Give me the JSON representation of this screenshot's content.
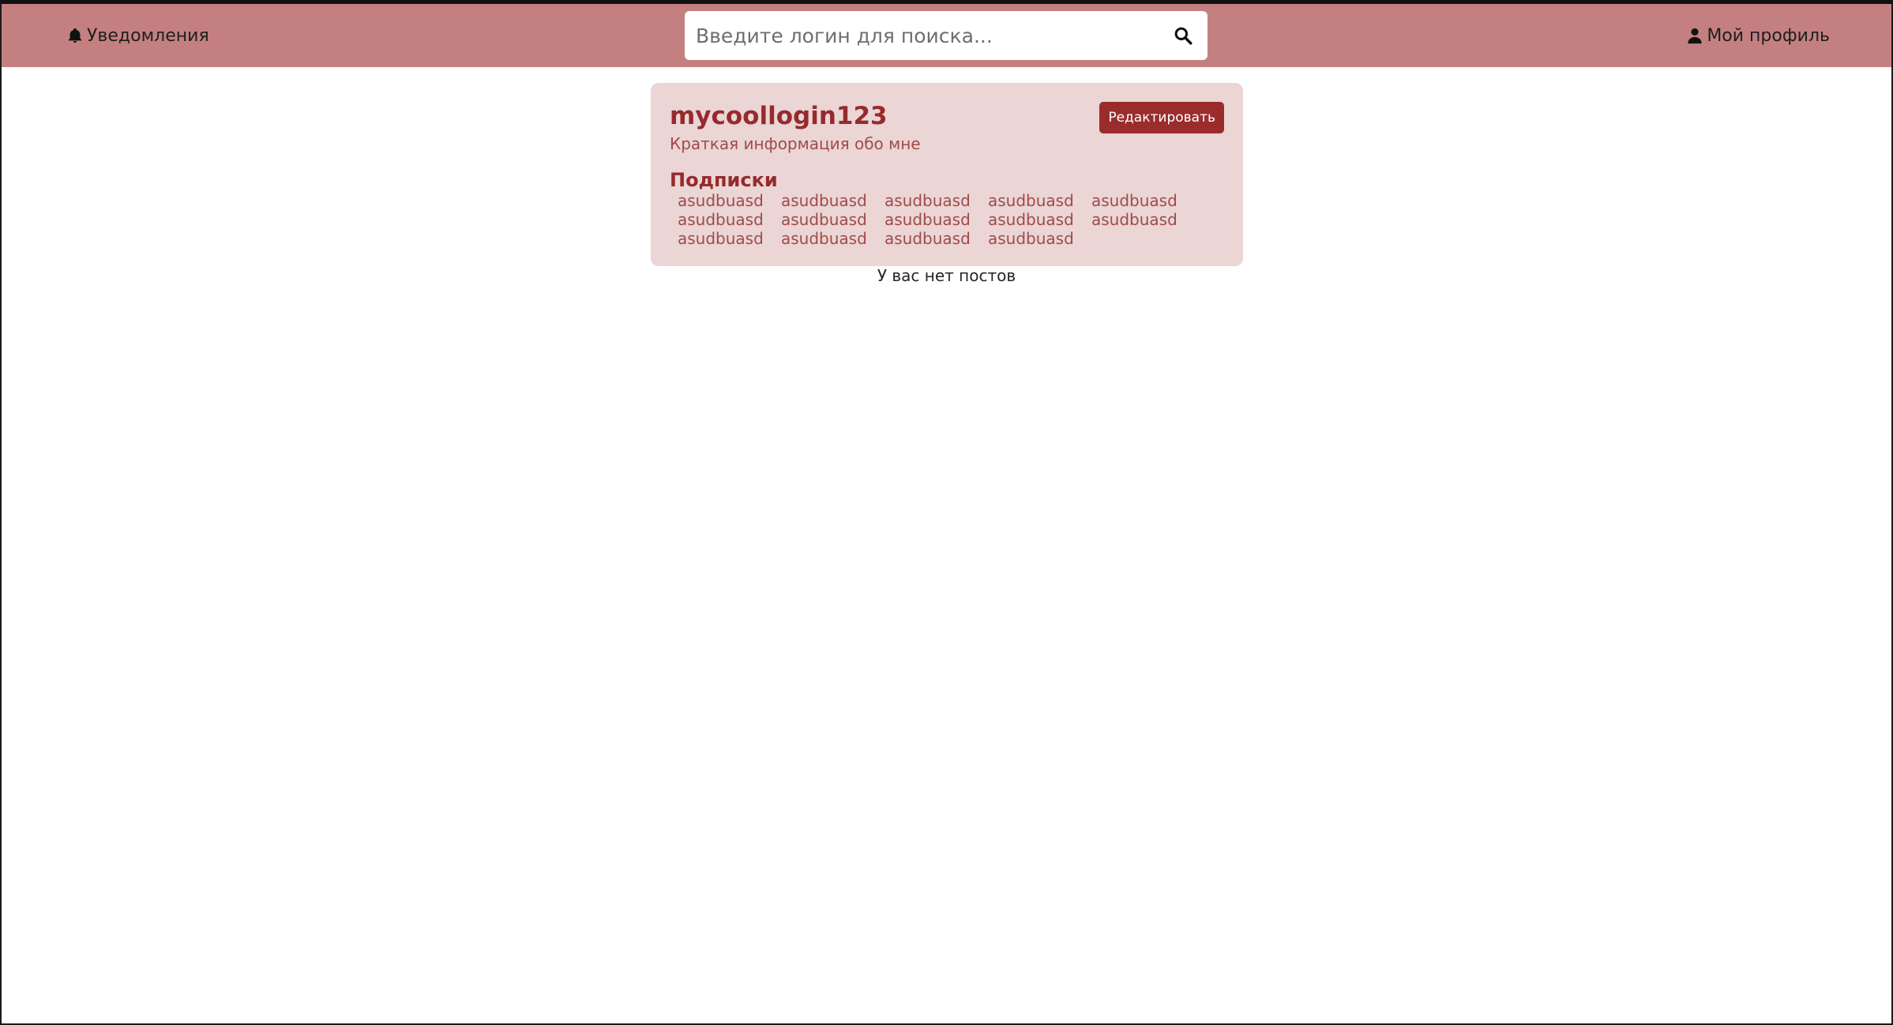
{
  "header": {
    "notifications_label": "Уведомления",
    "search_placeholder": "Введите логин для поиска...",
    "profile_label": "Мой профиль"
  },
  "profile": {
    "username": "mycoollogin123",
    "about": "Краткая информация обо мне",
    "edit_label": "Редактировать",
    "subscriptions_title": "Подписки",
    "subscriptions": [
      [
        "asudbuasd",
        "asudbuasd",
        "asudbuasd",
        "asudbuasd",
        "asudbuasd"
      ],
      [
        "asudbuasd",
        "asudbuasd",
        "asudbuasd",
        "asudbuasd",
        "asudbuasd"
      ],
      [
        "asudbuasd",
        "asudbuasd",
        "asudbuasd",
        "asudbuasd"
      ]
    ]
  },
  "posts": {
    "empty_text": "У вас нет постов"
  },
  "colors": {
    "topbar": "#c48080",
    "card": "#ebd5d5",
    "accent": "#962a2d",
    "button": "#9a2c2c"
  },
  "icons": {
    "notifications": "bell-icon",
    "search": "search-icon",
    "profile": "user-icon"
  }
}
